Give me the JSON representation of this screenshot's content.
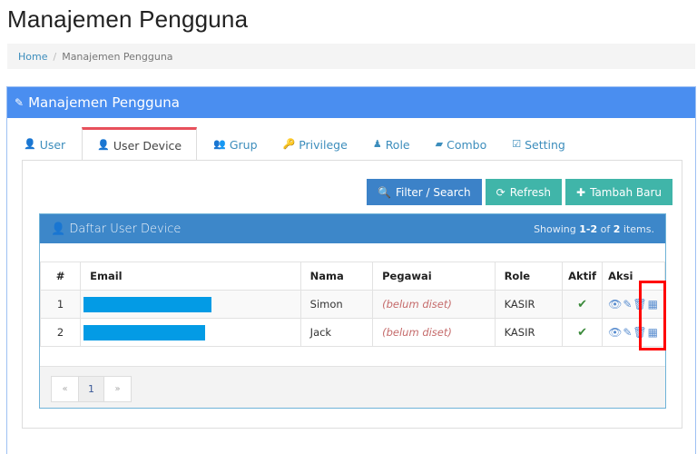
{
  "page": {
    "title": "Manajemen Pengguna"
  },
  "breadcrumb": {
    "home": "Home",
    "separator": "/",
    "current": "Manajemen Pengguna"
  },
  "panel": {
    "title": "Manajemen Pengguna",
    "icon": "pencil-icon"
  },
  "tabs": [
    {
      "label": "User",
      "icon": "user-icon",
      "active": false
    },
    {
      "label": "User Device",
      "icon": "user-icon",
      "active": true
    },
    {
      "label": "Grup",
      "icon": "users-icon",
      "active": false
    },
    {
      "label": "Privilege",
      "icon": "key-icon",
      "active": false
    },
    {
      "label": "Role",
      "icon": "user-tie-icon",
      "active": false
    },
    {
      "label": "Combo",
      "icon": "book-icon",
      "active": false
    },
    {
      "label": "Setting",
      "icon": "edit-icon",
      "active": false
    }
  ],
  "toolbar": {
    "filter_label": "Filter / Search",
    "refresh_label": "Refresh",
    "add_label": "Tambah Baru"
  },
  "list": {
    "title": "Daftar User Device",
    "summary_prefix": "Showing",
    "summary_range": "1-2",
    "summary_of": "of",
    "summary_total": "2",
    "summary_suffix": "items.",
    "columns": [
      "#",
      "Email",
      "Nama",
      "Pegawai",
      "Role",
      "Aktif",
      "Aksi"
    ],
    "rows": [
      {
        "no": "1",
        "email": "[redacted]",
        "nama": "Simon",
        "pegawai": "(belum diset)",
        "role": "KASIR",
        "aktif": "✔"
      },
      {
        "no": "2",
        "email": "[redacted]",
        "nama": "Jack",
        "pegawai": "(belum diset)",
        "role": "KASIR",
        "aktif": "✔"
      }
    ],
    "actions": [
      "view-icon",
      "edit-icon",
      "delete-icon",
      "calculator-icon"
    ]
  },
  "pagination": {
    "prev": "«",
    "current": "1",
    "next": "»"
  },
  "colors": {
    "panel_header": "#4a8ef0",
    "list_header": "#3d87c9",
    "btn_primary": "#3c82c8",
    "btn_success": "#40b5a9",
    "active_tab_border": "#e8505b",
    "highlight": "#ff0000"
  }
}
